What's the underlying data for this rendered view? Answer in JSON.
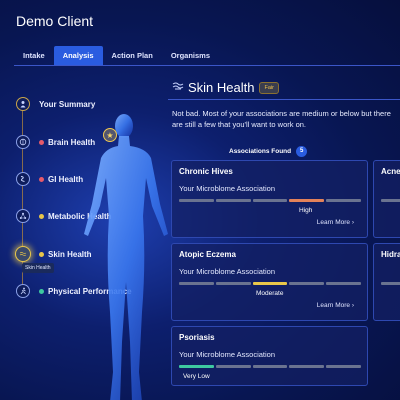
{
  "app": {
    "title": "Demo Client"
  },
  "tabs": [
    {
      "label": "Intake",
      "active": false
    },
    {
      "label": "Analysis",
      "active": true
    },
    {
      "label": "Action Plan",
      "active": false
    },
    {
      "label": "Organisms",
      "active": false
    }
  ],
  "nav": {
    "items": [
      {
        "label": "Your Summary",
        "icon": "person-icon",
        "dot": null
      },
      {
        "label": "Brain Health",
        "icon": "brain-icon",
        "dot": "#e65a6a"
      },
      {
        "label": "GI Health",
        "icon": "gut-icon",
        "dot": "#e65a6a"
      },
      {
        "label": "Metabolic Health",
        "icon": "molecule-icon",
        "dot": "#e8c64a"
      },
      {
        "label": "Skin Health",
        "icon": "skin-icon",
        "dot": "#e8c64a"
      },
      {
        "label": "Physical Performance",
        "icon": "activity-icon",
        "dot": "#3ec9a0"
      }
    ],
    "tooltip": "Skin Health"
  },
  "main": {
    "title": "Skin Health",
    "badge": "Fair",
    "description": "Not bad. Most of your associations are medium or below but there are still a few that you'll want to work on.",
    "associations_label": "Associations Found",
    "associations_count": "5"
  },
  "cards": [
    {
      "title": "Chronic Hives",
      "subtitle": "Your Microblome Association",
      "level": "High",
      "level_index": 3,
      "level_color": "#e3825a",
      "more": "Learn More"
    },
    {
      "title": "Atopic Eczema",
      "subtitle": "Your Microblome Association",
      "level": "Moderate",
      "level_index": 2,
      "level_color": "#e8c64a",
      "more": "Learn More"
    },
    {
      "title": "Psoriasis",
      "subtitle": "Your Microblome Association",
      "level": "Very Low",
      "level_index": 0,
      "level_color": "#3ec9a0",
      "more": ""
    },
    {
      "title": "Acne",
      "subtitle": "",
      "level": "",
      "more": ""
    },
    {
      "title": "Hidradenitis",
      "subtitle": "",
      "level": "",
      "more": ""
    }
  ],
  "colors": {
    "accent": "#2a5ce0",
    "high": "#e3825a",
    "moderate": "#e8c64a",
    "low": "#3ec9a0"
  }
}
